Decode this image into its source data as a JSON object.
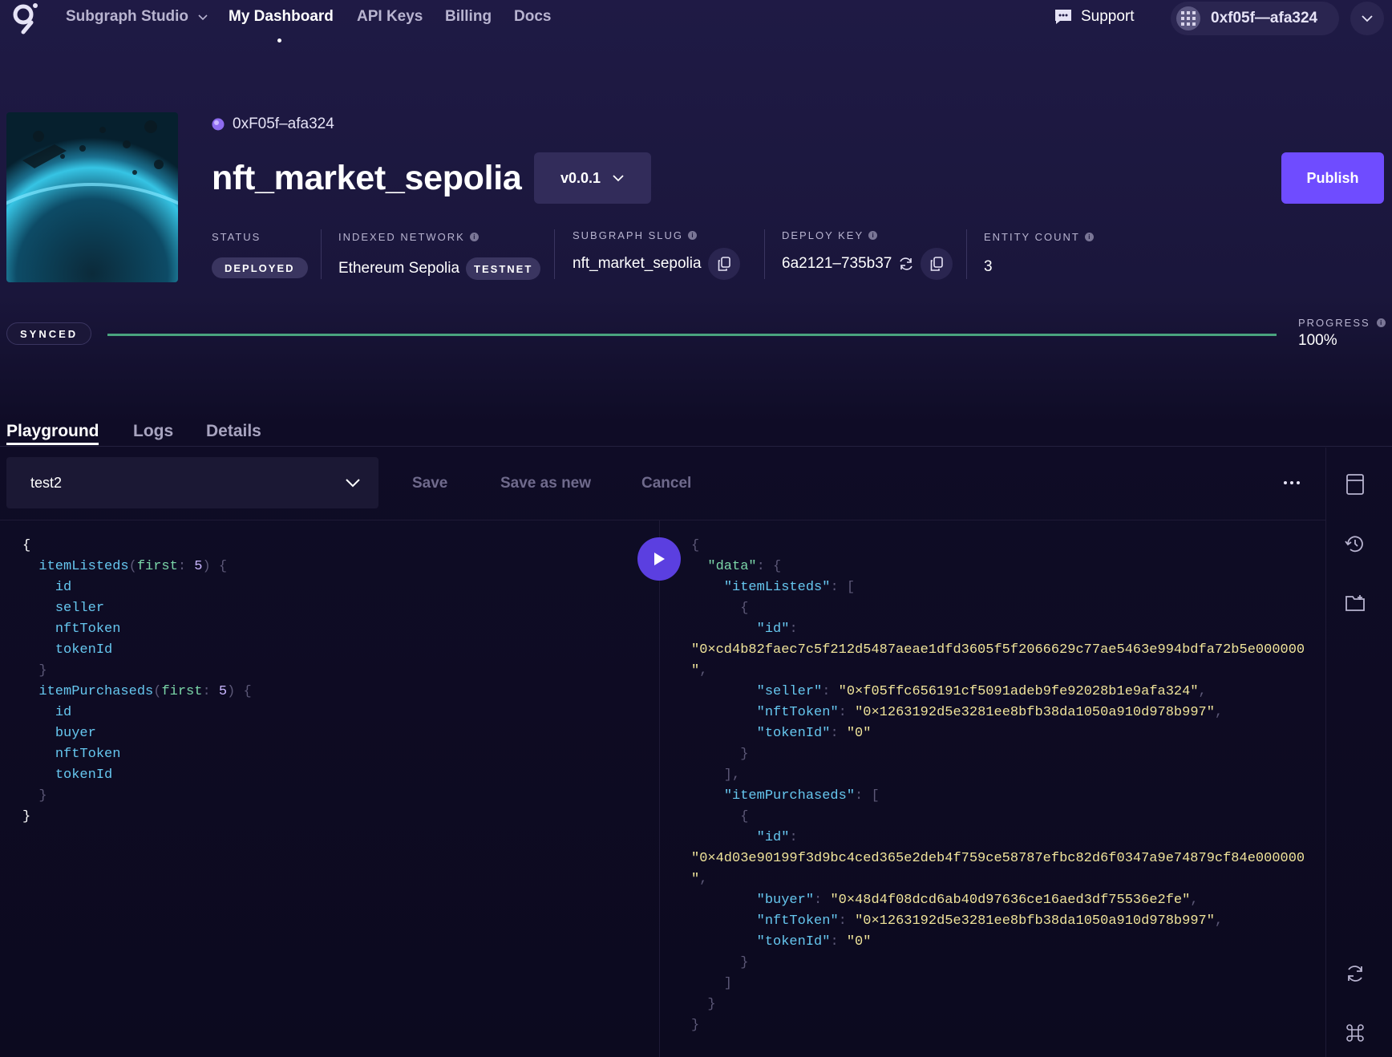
{
  "nav": {
    "studio_label": "Subgraph Studio",
    "items": [
      "My Dashboard",
      "API Keys",
      "Billing",
      "Docs"
    ],
    "support_label": "Support",
    "account_name": "0xf05f—afa324"
  },
  "header": {
    "owner": "0xF05f–afa324",
    "title": "nft_market_sepolia",
    "version": "v0.0.1",
    "publish_label": "Publish"
  },
  "meta": {
    "status_label": "STATUS",
    "status_value": "DEPLOYED",
    "network_label": "INDEXED NETWORK",
    "network_value": "Ethereum Sepolia",
    "network_badge": "TESTNET",
    "slug_label": "SUBGRAPH SLUG",
    "slug_value": "nft_market_sepolia",
    "deploy_key_label": "DEPLOY KEY",
    "deploy_key_value": "6a2121–735b37",
    "entity_label": "ENTITY COUNT",
    "entity_value": "3"
  },
  "sync": {
    "status": "SYNCED",
    "progress_label": "PROGRESS",
    "progress_text": "100%",
    "progress_fraction": 1.0
  },
  "tabs": [
    "Playground",
    "Logs",
    "Details"
  ],
  "playground": {
    "query_name": "test2",
    "save_label": "Save",
    "save_as_new_label": "Save as new",
    "cancel_label": "Cancel"
  },
  "query_lines": [
    [
      [
        "{",
        "brace"
      ]
    ],
    [
      [
        "  ",
        ""
      ],
      [
        "itemListeds",
        "field"
      ],
      [
        "(",
        "punc"
      ],
      [
        "first",
        "arg"
      ],
      [
        ": ",
        "punc"
      ],
      [
        "5",
        "num"
      ],
      [
        ") {",
        "punc"
      ]
    ],
    [
      [
        "    ",
        ""
      ],
      [
        "id",
        "field"
      ]
    ],
    [
      [
        "    ",
        ""
      ],
      [
        "seller",
        "field"
      ]
    ],
    [
      [
        "    ",
        ""
      ],
      [
        "nftToken",
        "field"
      ]
    ],
    [
      [
        "    ",
        ""
      ],
      [
        "tokenId",
        "field"
      ]
    ],
    [
      [
        "  }",
        "punc"
      ]
    ],
    [
      [
        "  ",
        ""
      ],
      [
        "itemPurchaseds",
        "field"
      ],
      [
        "(",
        "punc"
      ],
      [
        "first",
        "arg"
      ],
      [
        ": ",
        "punc"
      ],
      [
        "5",
        "num"
      ],
      [
        ") {",
        "punc"
      ]
    ],
    [
      [
        "    ",
        ""
      ],
      [
        "id",
        "field"
      ]
    ],
    [
      [
        "    ",
        ""
      ],
      [
        "buyer",
        "field"
      ]
    ],
    [
      [
        "    ",
        ""
      ],
      [
        "nftToken",
        "field"
      ]
    ],
    [
      [
        "    ",
        ""
      ],
      [
        "tokenId",
        "field"
      ]
    ],
    [
      [
        "  }",
        "punc"
      ]
    ],
    [
      [
        "}",
        "brace"
      ]
    ]
  ],
  "result_lines": [
    [
      [
        "{",
        "punc"
      ]
    ],
    [
      [
        "  ",
        ""
      ],
      [
        "\"data\"",
        "data"
      ],
      [
        ": {",
        "punc"
      ]
    ],
    [
      [
        "    ",
        ""
      ],
      [
        "\"itemListeds\"",
        "key"
      ],
      [
        ": [",
        "punc"
      ]
    ],
    [
      [
        "      {",
        "punc"
      ]
    ],
    [
      [
        "        ",
        ""
      ],
      [
        "\"id\"",
        "key"
      ],
      [
        ":",
        "punc"
      ]
    ],
    [
      [
        "\"0×cd4b82faec7c5f212d5487aeae1dfd3605f5f2066629c77ae5463e994bdfa72b5e000000",
        "str"
      ]
    ],
    [
      [
        "\"",
        "str"
      ],
      [
        ",",
        "punc"
      ]
    ],
    [
      [
        "        ",
        ""
      ],
      [
        "\"seller\"",
        "key"
      ],
      [
        ": ",
        "punc"
      ],
      [
        "\"0×f05ffc656191cf5091adeb9fe92028b1e9afa324\"",
        "str"
      ],
      [
        ",",
        "punc"
      ]
    ],
    [
      [
        "        ",
        ""
      ],
      [
        "\"nftToken\"",
        "key"
      ],
      [
        ": ",
        "punc"
      ],
      [
        "\"0×1263192d5e3281ee8bfb38da1050a910d978b997\"",
        "str"
      ],
      [
        ",",
        "punc"
      ]
    ],
    [
      [
        "        ",
        ""
      ],
      [
        "\"tokenId\"",
        "key"
      ],
      [
        ": ",
        "punc"
      ],
      [
        "\"0\"",
        "str"
      ]
    ],
    [
      [
        "      }",
        "punc"
      ]
    ],
    [
      [
        "    ],",
        "punc"
      ]
    ],
    [
      [
        "    ",
        ""
      ],
      [
        "\"itemPurchaseds\"",
        "key"
      ],
      [
        ": [",
        "punc"
      ]
    ],
    [
      [
        "      {",
        "punc"
      ]
    ],
    [
      [
        "        ",
        ""
      ],
      [
        "\"id\"",
        "key"
      ],
      [
        ":",
        "punc"
      ]
    ],
    [
      [
        "\"0×4d03e90199f3d9bc4ced365e2deb4f759ce58787efbc82d6f0347a9e74879cf84e000000",
        "str"
      ]
    ],
    [
      [
        "\"",
        "str"
      ],
      [
        ",",
        "punc"
      ]
    ],
    [
      [
        "        ",
        ""
      ],
      [
        "\"buyer\"",
        "key"
      ],
      [
        ": ",
        "punc"
      ],
      [
        "\"0×48d4f08dcd6ab40d97636ce16aed3df75536e2fe\"",
        "str"
      ],
      [
        ",",
        "punc"
      ]
    ],
    [
      [
        "        ",
        ""
      ],
      [
        "\"nftToken\"",
        "key"
      ],
      [
        ": ",
        "punc"
      ],
      [
        "\"0×1263192d5e3281ee8bfb38da1050a910d978b997\"",
        "str"
      ],
      [
        ",",
        "punc"
      ]
    ],
    [
      [
        "        ",
        ""
      ],
      [
        "\"tokenId\"",
        "key"
      ],
      [
        ": ",
        "punc"
      ],
      [
        "\"0\"",
        "str"
      ]
    ],
    [
      [
        "      }",
        "punc"
      ]
    ],
    [
      [
        "    ]",
        "punc"
      ]
    ],
    [
      [
        "  }",
        "punc"
      ]
    ],
    [
      [
        "}",
        "punc"
      ]
    ]
  ],
  "colors": {
    "accent": "#6f4cff",
    "run_button": "#5b3fe0",
    "progress": "#4aa37f"
  },
  "icons": [
    "graph-logo-icon",
    "chevron-down-icon",
    "chat-icon",
    "avatar-icon",
    "info-icon",
    "copy-icon",
    "refresh-icon",
    "play-icon",
    "document-icon",
    "history-icon",
    "folder-icon",
    "sync-icon",
    "command-icon"
  ]
}
